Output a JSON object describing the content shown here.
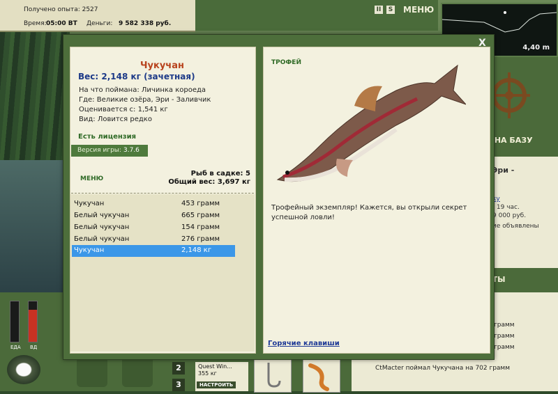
{
  "status": {
    "experience": "Получено опыта: 2527",
    "time_label": "Время:",
    "time_value": "05:00 ВТ",
    "money_label": "Деньги:",
    "money_value": "9 582 338 руб."
  },
  "top_menu": {
    "label": "МЕНЮ",
    "btn_pause": "II",
    "btn_s": "S"
  },
  "depth": {
    "value": "4,40 m"
  },
  "side": {
    "base_header": "ЯСЯ НА БАЗУ",
    "location_part": "ра. Эри -",
    "link_part": "ку",
    "hours": ": 19 час.",
    "price": "9 000 руб.",
    "ads": "ие объявлены",
    "secrets_header": "РЕТЫ",
    "feed": [
      "грамм",
      "грамм",
      "грамм",
      "CtMacter поймал Чукучана на 702 грамм"
    ]
  },
  "bottom": {
    "food_label": "ЕДА",
    "vd_label": "ВД",
    "slot2": "2",
    "slot3": "3",
    "quest_title": "Quest Win...",
    "quest_weight": "355 кг",
    "setup_button": "НАСТРОИТЬ",
    "food_level": 0.0,
    "vd_level": 0.8
  },
  "dialog": {
    "fish_name": "Чукучан",
    "weight": "Вес: 2,148 кг (зачетная)",
    "caught_on": "На что поймана: Личинка короеда",
    "location": "Где: Великие озёра, Эри - Заливчик",
    "valuation": "Оценивается с: 1,541 кг",
    "kind": "Вид: Ловится редко",
    "license": "Есть лицензия",
    "version_label": "Версия игры:",
    "version_value": "3.7.6",
    "menu_label": "МЕНЮ",
    "keepnet_count": "Рыб в садке: 5",
    "total_weight": "Общий вес: 3,697 кг",
    "catch_list": [
      {
        "name": "Чукучан",
        "weight": "453 грамм",
        "selected": false
      },
      {
        "name": "Белый чукучан",
        "weight": "665 грамм",
        "selected": false
      },
      {
        "name": "Белый чукучан",
        "weight": "154 грамм",
        "selected": false
      },
      {
        "name": "Белый чукучан",
        "weight": "276 грамм",
        "selected": false
      },
      {
        "name": "Чукучан",
        "weight": "2,148 кг",
        "selected": true
      }
    ],
    "trophy_label": "ТРОФЕЙ",
    "trophy_text": "Трофейный экземпляр! Кажется, вы открыли секрет успешной ловли!",
    "hotkeys_label": "Горячие клавиши",
    "close": "X"
  }
}
